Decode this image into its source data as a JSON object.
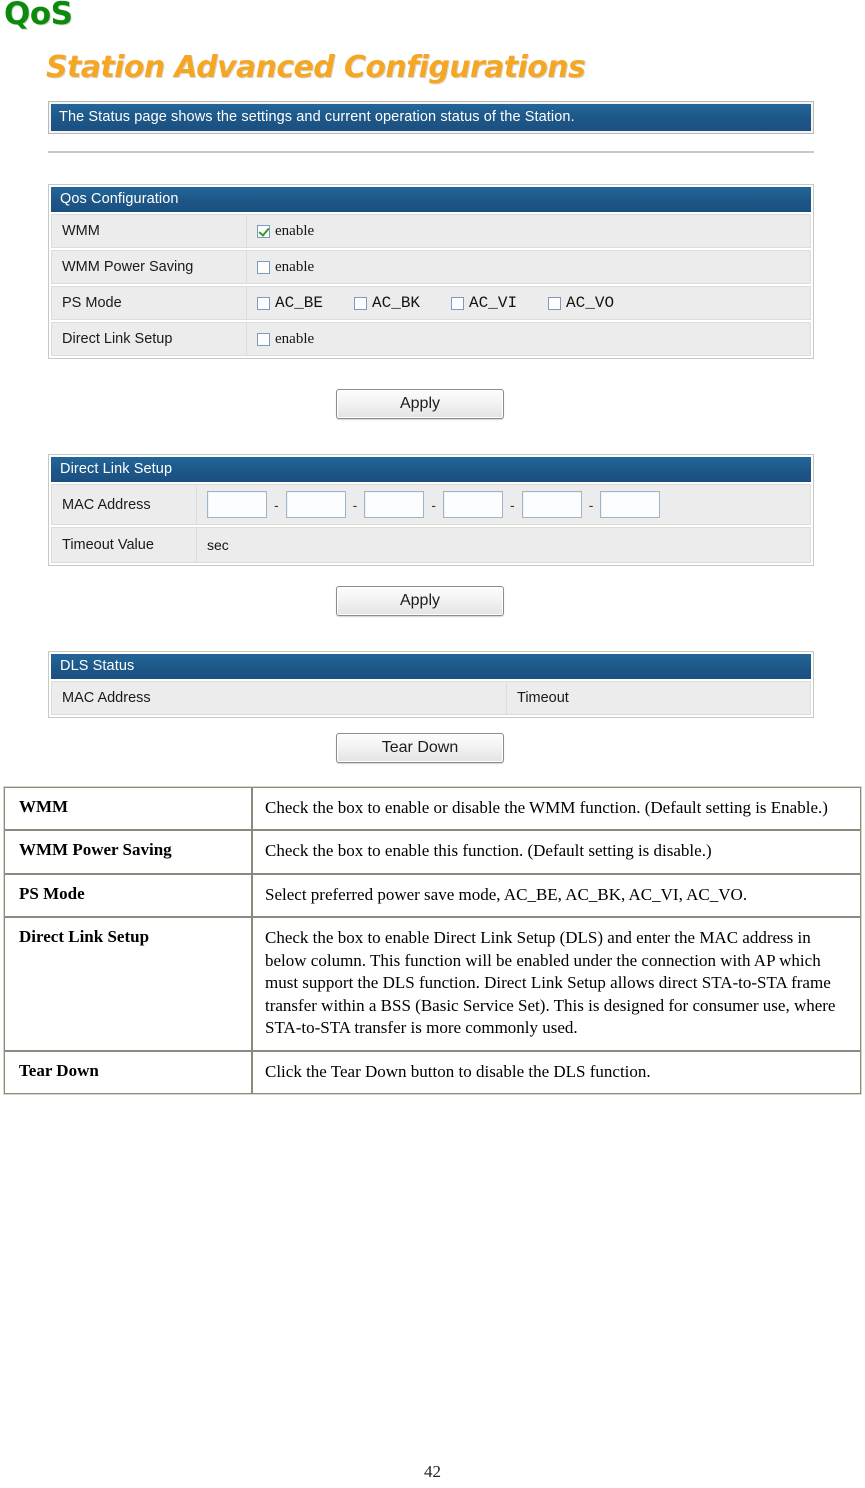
{
  "heading": "QoS",
  "screen": {
    "title": "Station Advanced Configurations",
    "description_bar": "The Status page shows the settings and current operation status of the Station.",
    "qos_panel": {
      "header": "Qos Configuration",
      "rows": [
        {
          "label": "WMM",
          "checkbox_label": "enable",
          "checked": true
        },
        {
          "label": "WMM Power Saving",
          "checkbox_label": "enable",
          "checked": false
        },
        {
          "label": "PS Mode",
          "options": [
            {
              "label": "AC_BE",
              "checked": false
            },
            {
              "label": "AC_BK",
              "checked": false
            },
            {
              "label": "AC_VI",
              "checked": false
            },
            {
              "label": "AC_VO",
              "checked": false
            }
          ]
        },
        {
          "label": "Direct Link Setup",
          "checkbox_label": "enable",
          "checked": false
        }
      ],
      "apply_button": "Apply"
    },
    "dls_panel": {
      "header": "Direct Link Setup",
      "mac_label": "MAC Address",
      "mac_values": [
        "",
        "",
        "",
        "",
        "",
        ""
      ],
      "mac_separator": "-",
      "timeout_label": "Timeout Value",
      "timeout_unit": "sec",
      "apply_button": "Apply"
    },
    "dls_status_panel": {
      "header": "DLS Status",
      "col_mac": "MAC Address",
      "col_timeout": "Timeout",
      "tear_down_button": "Tear Down"
    },
    "colors": {
      "panel_blue": "#1d5787",
      "title_orange": "#f5a623",
      "heading_green": "#0b8a0b",
      "check_green": "#2d9b2d"
    }
  },
  "description_table": {
    "rows": [
      {
        "term": "WMM",
        "definition": "Check the box to enable or disable the WMM function. (Default setting is Enable.)"
      },
      {
        "term": "WMM Power Saving",
        "definition": "Check the box to enable this function. (Default setting is disable.)"
      },
      {
        "term": "PS Mode",
        "definition": "Select preferred power save mode, AC_BE, AC_BK, AC_VI, AC_VO."
      },
      {
        "term": "Direct Link Setup",
        "definition": "Check the box to enable Direct Link Setup (DLS) and enter the MAC address in below column. This function will be enabled under the connection with AP which must support the DLS function. Direct Link Setup allows direct STA-to-STA frame transfer within a BSS (Basic Service Set). This is designed for consumer use, where STA-to-STA transfer is more commonly used."
      },
      {
        "term": "Tear Down",
        "definition": "Click the Tear Down button to disable the DLS function."
      }
    ]
  },
  "page_number": "42"
}
